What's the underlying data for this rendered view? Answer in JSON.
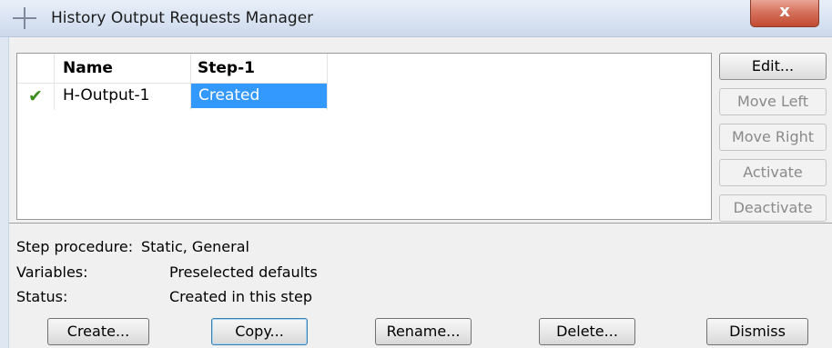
{
  "window": {
    "title": "History Output Requests Manager",
    "close_glyph": "x"
  },
  "table": {
    "columns": [
      "Name",
      "Step-1"
    ],
    "rows": [
      {
        "active": true,
        "name": "H-Output-1",
        "step1": "Created"
      }
    ]
  },
  "side_buttons": {
    "edit": "Edit...",
    "move_left": "Move Left",
    "move_right": "Move Right",
    "activate": "Activate",
    "deactivate": "Deactivate"
  },
  "info": {
    "step_procedure_label": "Step procedure:",
    "step_procedure_value": "Static, General",
    "variables_label": "Variables:",
    "variables_value": "Preselected defaults",
    "status_label": "Status:",
    "status_value": "Created in this step"
  },
  "bottom_buttons": {
    "create": "Create...",
    "copy": "Copy...",
    "rename": "Rename...",
    "delete": "Delete...",
    "dismiss": "Dismiss"
  },
  "colors": {
    "selection": "#3399ff",
    "check": "#3b8d1b",
    "close": "#c14a32"
  },
  "icons": {
    "window": "crosshair-icon",
    "close": "close-icon",
    "active": "checkmark-icon"
  }
}
